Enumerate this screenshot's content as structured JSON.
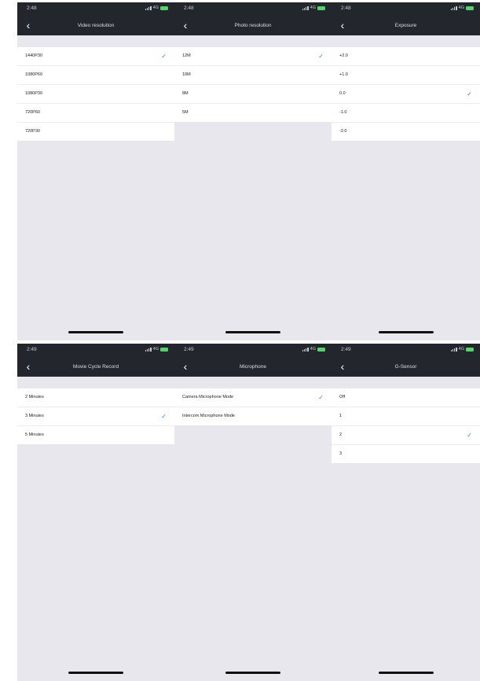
{
  "screens": [
    {
      "time": "2:48",
      "network": "4G",
      "title": "Video resolution",
      "items": [
        "1440P30",
        "1080P60",
        "1080P30",
        "720P60",
        "720P30"
      ],
      "selected": 0
    },
    {
      "time": "2:48",
      "network": "4G",
      "title": "Photo resolution",
      "items": [
        "12M",
        "10M",
        "8M",
        "5M"
      ],
      "selected": 0
    },
    {
      "time": "2:48",
      "network": "4G",
      "title": "Exposure",
      "items": [
        "+2.0",
        "+1.0",
        "0.0",
        "-1.0",
        "-2.0"
      ],
      "selected": 2
    },
    {
      "time": "2:49",
      "network": "4G",
      "title": "Movie Cycle Record",
      "items": [
        "2 Minutes",
        "3 Minutes",
        "5 Minutes"
      ],
      "selected": 1
    },
    {
      "time": "2:49",
      "network": "4G",
      "title": "Microphone",
      "items": [
        "Camera Microphone Mode",
        "Intercom Microphone Mode"
      ],
      "selected": 0
    },
    {
      "time": "2:49",
      "network": "4G",
      "title": "G-Sensor",
      "items": [
        "Off",
        "1",
        "2",
        "3"
      ],
      "selected": 2
    }
  ],
  "check_glyph": "✓",
  "back_glyph": "‹",
  "colors": {
    "header": "#23262d",
    "background": "#e8e7ee",
    "check": "#2f7cf6",
    "battery": "#4cd964"
  }
}
